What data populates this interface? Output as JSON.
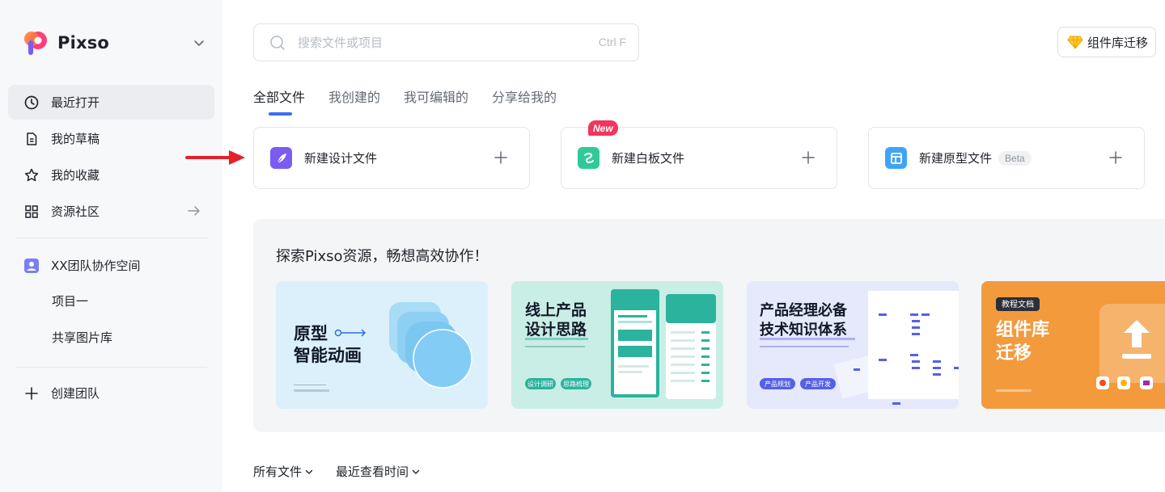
{
  "brand": {
    "name": "Pixso"
  },
  "sidebar": {
    "nav": [
      {
        "label": "最近打开",
        "icon": "clock-icon",
        "active": true
      },
      {
        "label": "我的草稿",
        "icon": "draft-icon"
      },
      {
        "label": "我的收藏",
        "icon": "star-icon"
      },
      {
        "label": "资源社区",
        "icon": "grid-icon"
      }
    ],
    "team": {
      "name": "XX团队协作空间",
      "projects": [
        "项目一",
        "共享图片库"
      ]
    },
    "create_team": "创建团队"
  },
  "search": {
    "placeholder": "搜索文件或项目",
    "shortcut": "Ctrl F"
  },
  "migrate_button": "组件库迁移",
  "tabs": [
    "全部文件",
    "我创建的",
    "我可编辑的",
    "分享给我的"
  ],
  "new_files": [
    {
      "label": "新建设计文件"
    },
    {
      "label": "新建白板文件",
      "badge": "New"
    },
    {
      "label": "新建原型文件",
      "badge": "Beta"
    }
  ],
  "explore": {
    "title": "探索Pixso资源，畅想高效协作！",
    "cards": [
      {
        "title_line1": "原型",
        "title_line2": "智能动画"
      },
      {
        "title_line1": "线上产品",
        "title_line2": "设计思路",
        "tags": [
          "设计调研",
          "思路梳理"
        ]
      },
      {
        "title_line1": "产品经理必备",
        "title_line2": "技术知识体系",
        "tags": [
          "产品规划",
          "产品开发"
        ]
      },
      {
        "badge": "教程文档",
        "title_line1": "组件库",
        "title_line2": "迁移"
      }
    ]
  },
  "filters": {
    "all_files": "所有文件",
    "sort": "最近查看时间"
  },
  "colors": {
    "accent": "#3c6cf5",
    "sidebar_bg": "#f7f8fa",
    "design_icon": "#7b5cf0",
    "whiteboard_icon": "#2fc99a",
    "prototype_icon": "#3fa4f7"
  }
}
